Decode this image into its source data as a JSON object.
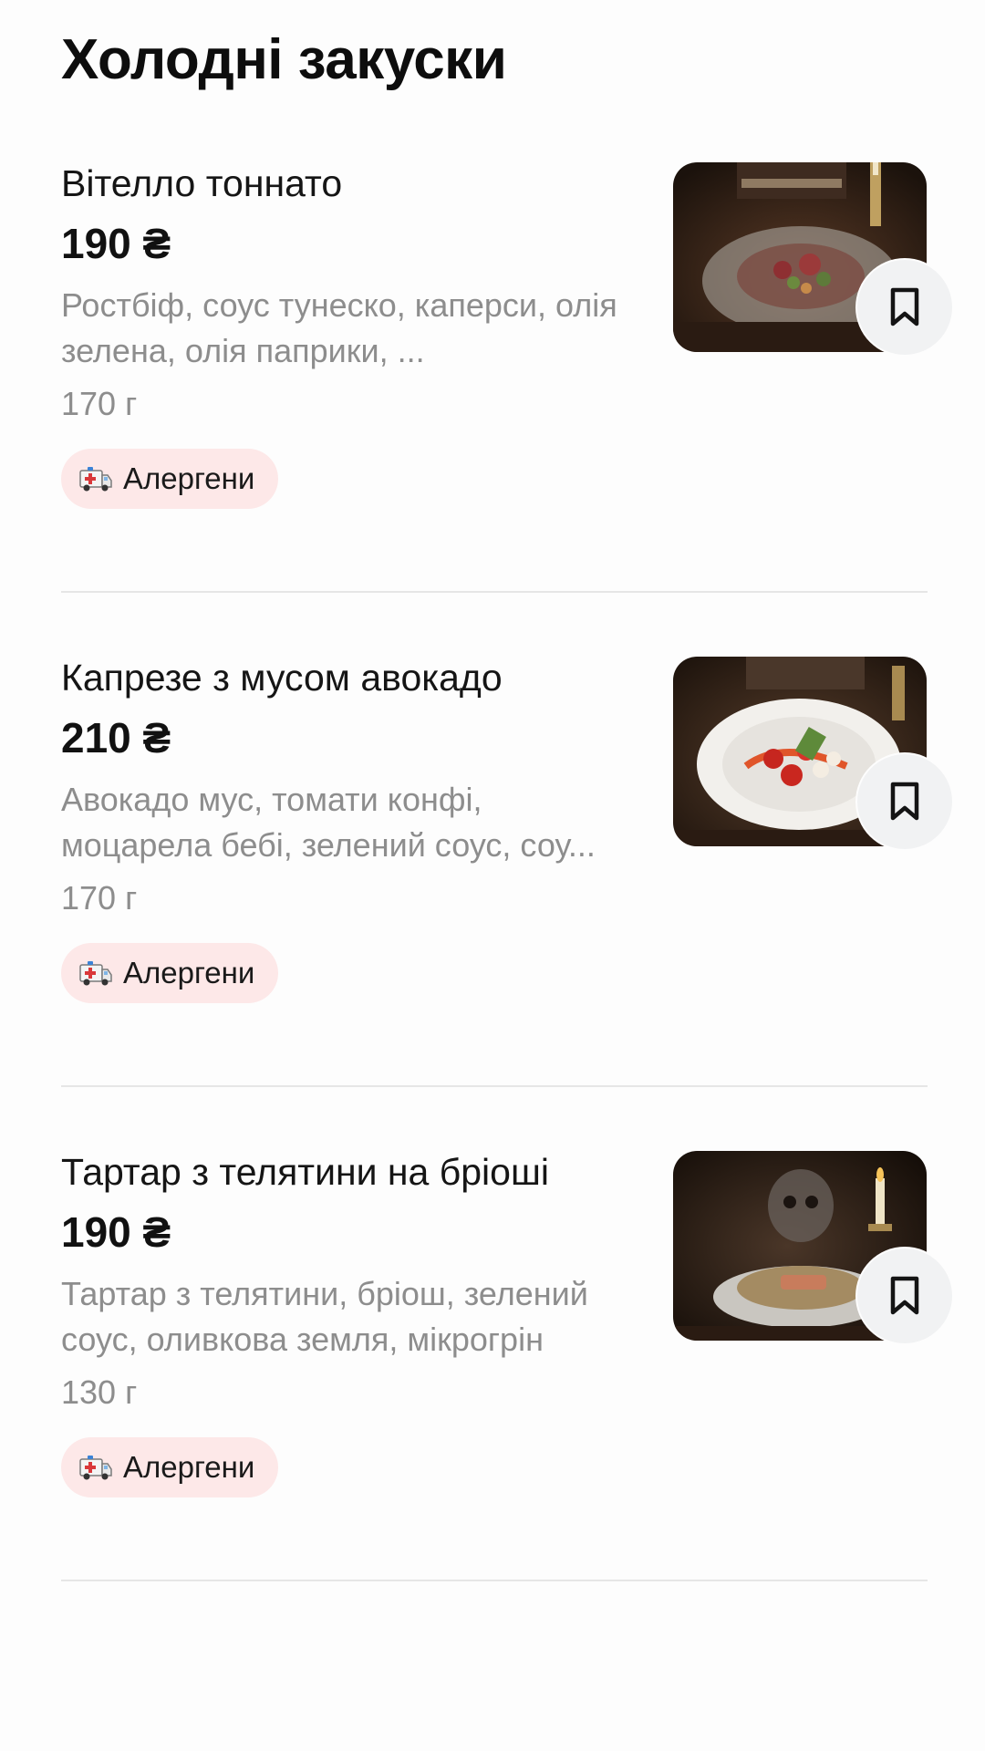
{
  "section": {
    "title": "Холодні закуски"
  },
  "items": [
    {
      "name": "Вітелло тоннато",
      "price": "190 ₴",
      "description": "Ростбіф, соус тунеско, каперси, олія зелена, олія паприки, ...",
      "weight": "170 г",
      "allergens_label": "Алергени"
    },
    {
      "name": "Капрезе з мусом авокадо",
      "price": "210 ₴",
      "description": "Авокадо мус, томати конфі, моцарела бебі, зелений соус, соу...",
      "weight": "170 г",
      "allergens_label": "Алергени"
    },
    {
      "name": "Тартар з телятини на бріоші",
      "price": "190 ₴",
      "description": "Тартар з телятини, бріош, зелений соус, оливкова земля, мікрогрін",
      "weight": "130 г",
      "allergens_label": "Алергени"
    }
  ],
  "icons": {
    "bookmark": "bookmark-icon",
    "allergen": "ambulance-icon"
  },
  "colors": {
    "chip_background": "#fde8e8",
    "muted_text": "#8d8d8d",
    "bookmark_background": "#f1f2f3"
  }
}
